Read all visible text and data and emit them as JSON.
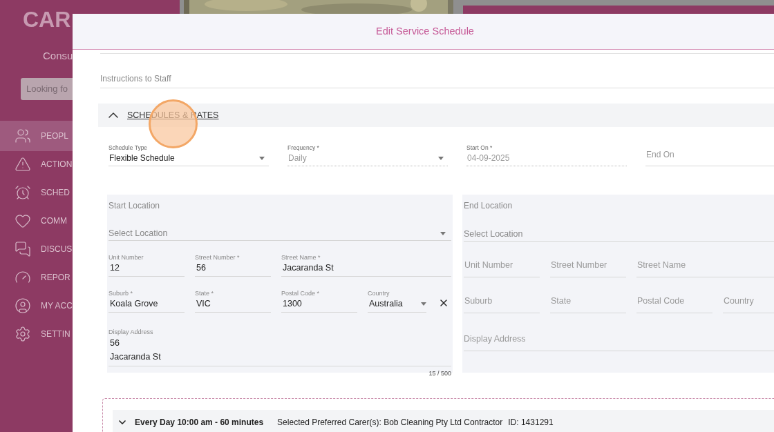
{
  "background": {
    "logo": "CAR",
    "subtitle": "Consu",
    "search": {
      "placeholder": "Looking fo"
    },
    "sidebar_items": [
      {
        "label": "PEOPL",
        "selected": true
      },
      {
        "label": "ACTION",
        "selected": false
      },
      {
        "label": "SCHED",
        "selected": false
      },
      {
        "label": "COMM",
        "selected": false
      },
      {
        "label": "DISCUS",
        "selected": false
      },
      {
        "label": "REPOR",
        "selected": false
      },
      {
        "label": "MY ACC",
        "selected": false
      },
      {
        "label": "SETTIN",
        "selected": false
      }
    ]
  },
  "dialog": {
    "title": "Edit Service Schedule",
    "instructions_field": {
      "placeholder": "Instructions to Staff"
    },
    "section": {
      "title": "SCHEDULES & RATES",
      "expanded": true
    },
    "schedule_fields": [
      {
        "kind": "select",
        "label": "Schedule Type",
        "value": "Flexible Schedule",
        "disabled": false
      },
      {
        "kind": "select",
        "label": "Frequency *",
        "value": "Daily",
        "disabled": true
      },
      {
        "kind": "input",
        "label": "Start On *",
        "value": "04-09-2025",
        "disabled": true
      },
      {
        "kind": "input",
        "placeholder": "End On",
        "disabled": false
      }
    ],
    "start_location": {
      "title": "Start Location",
      "select_placeholder": "Select Location",
      "rows": [
        [
          {
            "kind": "input",
            "label": "Unit Number",
            "value": "12"
          },
          {
            "kind": "input",
            "label": "Street Number *",
            "value": "56"
          },
          {
            "kind": "input",
            "label": "Street Name *",
            "value": "Jacaranda St"
          }
        ],
        [
          {
            "kind": "input",
            "label": "Suburb *",
            "value": "Koala Grove"
          },
          {
            "kind": "input",
            "label": "State *",
            "value": "VIC"
          },
          {
            "kind": "input",
            "label": "Postal Code *",
            "value": "1300"
          },
          {
            "kind": "select",
            "label": "Country",
            "value": "Australia",
            "clearable": true
          }
        ]
      ],
      "display_address": {
        "label": "Display Address",
        "value": "56\nJacaranda St",
        "counter": "15 / 500"
      }
    },
    "end_location": {
      "title": "End Location",
      "select_placeholder": "Select Location",
      "rows": [
        [
          {
            "kind": "input",
            "placeholder": "Unit Number"
          },
          {
            "kind": "input",
            "placeholder": "Street Number"
          },
          {
            "kind": "input",
            "placeholder": "Street Name"
          }
        ],
        [
          {
            "kind": "input",
            "placeholder": "Suburb"
          },
          {
            "kind": "input",
            "placeholder": "State"
          },
          {
            "kind": "input",
            "placeholder": "Postal Code"
          },
          {
            "kind": "select",
            "placeholder": "Country",
            "clearable": false
          }
        ]
      ],
      "display_address": {
        "placeholder": "Display Address"
      }
    },
    "schedule_item": {
      "expanded": false,
      "summary": "Every Day 10:00 am - 60 minutes",
      "carers": "Selected Preferred Carer(s): Bob Cleaning Pty Ltd Contractor",
      "id": "ID: 1431291"
    }
  }
}
